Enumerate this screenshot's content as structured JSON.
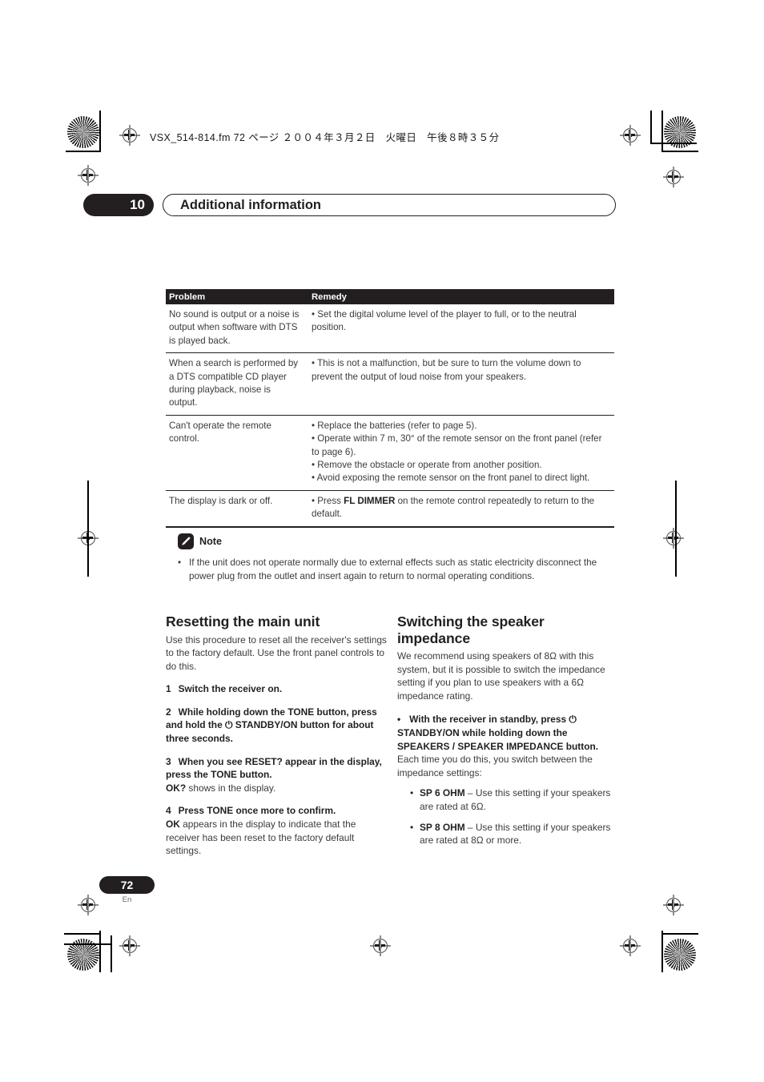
{
  "print_marks": {
    "file_line": "VSX_514-814.fm  72 ページ  ２００４年３月２日　火曜日　午後８時３５分"
  },
  "running_head": {
    "chapter_number": "10",
    "chapter_title": "Additional information"
  },
  "troubleshooting_table": {
    "columns": [
      "Problem",
      "Remedy"
    ],
    "rows": [
      {
        "problem": "No sound is output or a noise is output when software with DTS is played back.",
        "remedies": [
          "Set the digital volume level of the player to full, or to the neutral position."
        ]
      },
      {
        "problem": "When a search is performed by a DTS compatible CD player during playback, noise is output.",
        "remedies": [
          "This is not a malfunction, but be sure to turn the volume down to prevent the output of loud noise from your speakers."
        ]
      },
      {
        "problem": "Can't operate the remote control.",
        "remedies": [
          "Replace the batteries (refer to page 5).",
          "Operate within 7 m, 30° of the remote sensor on the front panel (refer to page 6).",
          "Remove the obstacle or operate from another position.",
          "Avoid exposing the remote sensor on the front panel to direct light."
        ]
      },
      {
        "problem": "The display is dark or off.",
        "remedy_prefix": "Press ",
        "remedy_bold": "FL DIMMER",
        "remedy_suffix": " on the remote control repeatedly to return to the default."
      }
    ]
  },
  "note": {
    "icon": "pencil-note-icon",
    "title": "Note",
    "bullet": "•",
    "text": "If the unit does not operate normally due to external effects such as static electricity disconnect the power plug from the outlet and insert again to return to normal operating conditions."
  },
  "left_column": {
    "heading": "Resetting the main unit",
    "intro": "Use this procedure to reset all the receiver's settings to the factory default. Use the front panel controls to do this.",
    "steps": [
      {
        "number": "1",
        "bold": "Switch the receiver on.",
        "after": ""
      },
      {
        "number": "2",
        "bold_a": "While holding down the TONE button, press and hold the ",
        "power_symbol": "⏻",
        "bold_b": " STANDBY/ON button for about three seconds.",
        "after": ""
      },
      {
        "number": "3",
        "bold": "When you see RESET? appear in the display, press the TONE button.",
        "after_bold": "OK?",
        "after": " shows in the display."
      },
      {
        "number": "4",
        "bold": "Press TONE once more to confirm.",
        "after_bold": "OK",
        "after": " appears in the display to indicate that the receiver has been reset to the factory default settings."
      }
    ]
  },
  "right_column": {
    "heading": "Switching the speaker impedance",
    "intro": "We recommend using speakers of 8Ω with this system, but it is possible to switch the impedance setting if you plan to use speakers with a 6Ω impedance rating.",
    "bullet_instruction": {
      "bullet": "•",
      "bold_a": "With the receiver in standby, press ",
      "power_symbol": "⏻",
      "bold_b": " STANDBY/ON while holding down the SPEAKERS / SPEAKER IMPEDANCE button.",
      "after": "Each time you do this, you switch between the impedance settings:"
    },
    "settings": [
      {
        "bullet": "•",
        "name": "SP 6 OHM",
        "desc": " – Use this setting if your speakers are rated at 6Ω."
      },
      {
        "bullet": "•",
        "name": "SP 8 OHM",
        "desc": " – Use this setting if your speakers are rated at 8Ω or more."
      }
    ]
  },
  "folio": {
    "page_number": "72",
    "language_code": "En"
  }
}
